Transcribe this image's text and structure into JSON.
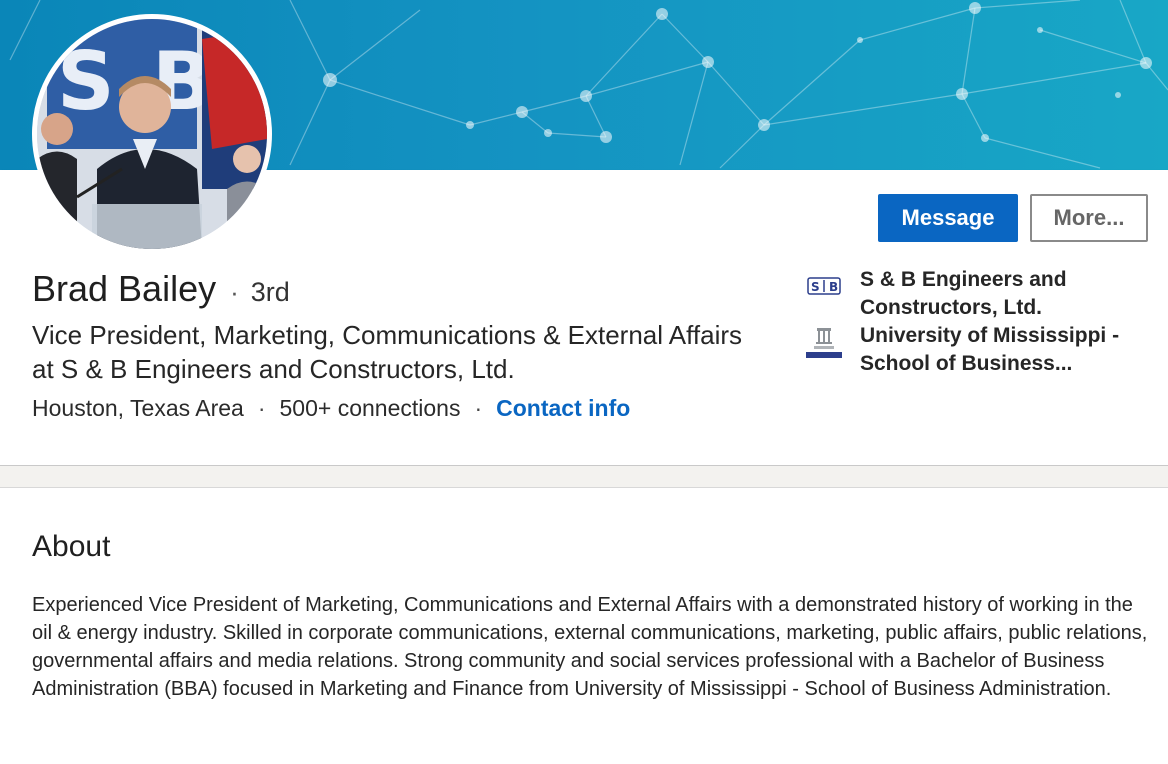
{
  "profile": {
    "name": "Brad Bailey",
    "separator": "·",
    "degree": "3rd",
    "headline": "Vice President, Marketing, Communications & External Affairs at S & B Engineers and Constructors, Ltd.",
    "location": "Houston, Texas Area",
    "connections": "500+ connections",
    "contact_info": "Contact info"
  },
  "actions": {
    "message_label": "Message",
    "more_label": "More..."
  },
  "orgs": [
    {
      "name": "S & B Engineers and Constructors, Ltd.",
      "logo": "sb-logo-icon"
    },
    {
      "name": "University of Mississippi - School of Business...",
      "logo": "ole-miss-business-logo-icon"
    }
  ],
  "about": {
    "title": "About",
    "text": "Experienced Vice President of Marketing, Communications and External Affairs with a demonstrated history of working in the oil & energy industry. Skilled in corporate communications, external communications, marketing, public affairs, public relations, governmental affairs and media relations. Strong community and social services professional with a Bachelor of Business Administration (BBA) focused in Marketing and Finance from University of Mississippi - School of Business Administration."
  },
  "colors": {
    "primary": "#0a66c2",
    "banner": "#1493c2"
  }
}
